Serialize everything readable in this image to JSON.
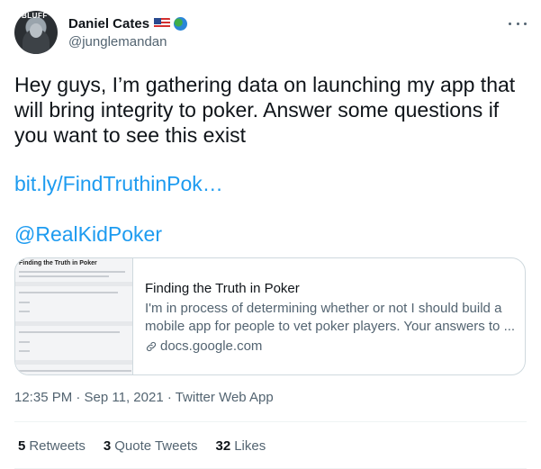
{
  "author": {
    "name": "Daniel Cates",
    "handle": "@junglemandan",
    "avatar_text": "BLUFF",
    "badges": [
      "us-flag-emoji",
      "globe-emoji"
    ]
  },
  "tweet": {
    "text": "Hey guys, I’m gathering data on launching my app that will bring integrity to poker. Answer some questions if you want to see this exist",
    "link": "bit.ly/FindTruthinPok…",
    "mention": "@RealKidPoker"
  },
  "card": {
    "thumbnail_title": "Finding the Truth in Poker",
    "title": "Finding the Truth in Poker",
    "description": "I'm in process of determining whether or not I should build a mobile app for people to vet poker players. Your answers to ...",
    "domain": "docs.google.com"
  },
  "meta": {
    "timestamp": "12:35 PM · Sep 11, 2021 · Twitter Web App"
  },
  "stats": [
    {
      "count": "5",
      "label": "Retweets"
    },
    {
      "count": "3",
      "label": "Quote Tweets"
    },
    {
      "count": "32",
      "label": "Likes"
    }
  ],
  "colors": {
    "link": "#1d9bf0",
    "secondary_text": "#536471",
    "primary_text": "#0f1419",
    "border": "#cfd9de"
  }
}
